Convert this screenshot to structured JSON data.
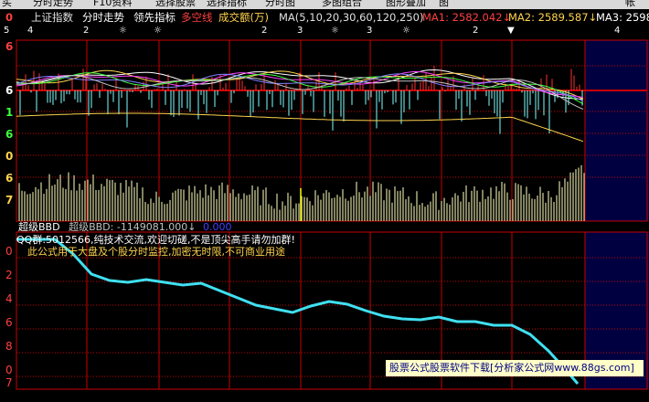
{
  "tabs": [
    "买",
    "分时走势",
    "F10资料",
    "选择股票",
    "选择指标",
    "分时图",
    "多图组合",
    "图形叠加",
    "图",
    "帐"
  ],
  "header": {
    "marker": "0",
    "stock_name": "上证指数",
    "view_label": "分时走势",
    "item_lead": "领先指标",
    "item_multi": "多空线",
    "item_volume": "成交额(万)",
    "ma_params": "MA(5,10,20,30,60,120,250)",
    "ma1": "MA1: 2582.042↓",
    "ma2": "MA2: 2589.587↓",
    "ma3": "MA3: 2598"
  },
  "markers": [
    {
      "text": "5"
    },
    {
      "text": "4"
    },
    {
      "text": "2"
    },
    {
      "text": "☼"
    },
    {
      "text": "☼"
    },
    {
      "text": "2"
    },
    {
      "text": "3"
    },
    {
      "text": "☼"
    },
    {
      "text": "3"
    },
    {
      "text": "☼"
    },
    {
      "text": "2"
    },
    {
      "text": "▼"
    },
    {
      "text": "4"
    }
  ],
  "left_axis_top": [
    "6",
    "6",
    "1",
    "6",
    "0",
    "6",
    "7"
  ],
  "indicator": {
    "title": "超级BBD",
    "value_label": "超级BBD: -1149081.000↓",
    "value_tail": "0.000",
    "note1": "QQ群:5012566,纯技术交流,欢迎切磋,不是顶尖高手请勿加群!",
    "note2": "此公式用于大盘及个股分时监控,加密无时限,不可商业用途"
  },
  "left_axis_bottom": [
    "0",
    "2",
    "4",
    "6",
    "8",
    "0",
    "7",
    "6"
  ],
  "watermark": "股票公式股票软件下载[分析家公式网www.88gs.com]",
  "colors": {
    "grid_red": "#c80000",
    "cyan_line": "#40e0f0",
    "volume_bar": "#d8d8a0",
    "yellow": "#ffd34d",
    "white": "#ffffff",
    "right_panel": "#000040"
  }
}
